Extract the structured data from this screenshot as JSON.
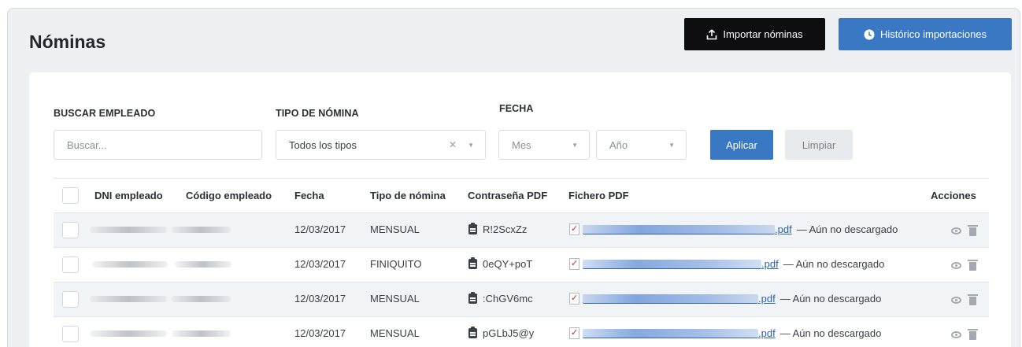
{
  "header": {
    "title": "Nóminas",
    "import_button": "Importar nóminas",
    "import_icon": "upload-icon",
    "history_button": "Histórico importaciones",
    "history_icon": "clock-icon"
  },
  "filters": {
    "search_label": "BUSCAR EMPLEADO",
    "search_placeholder": "Buscar...",
    "type_label": "TIPO DE NÓMINA",
    "type_value": "Todos los tipos",
    "date_label": "FECHA",
    "month_placeholder": "Mes",
    "year_placeholder": "Año",
    "apply_button": "Aplicar",
    "clear_button": "Limpiar"
  },
  "table": {
    "columns": {
      "dni": "DNI empleado",
      "code": "Código empleado",
      "date": "Fecha",
      "type": "Tipo de nómina",
      "password": "Contraseña PDF",
      "file": "Fichero PDF",
      "actions": "Acciones"
    },
    "rows": [
      {
        "date": "12/03/2017",
        "type": "MENSUAL",
        "password": "R!2ScxZz",
        "file_ext": ".pdf",
        "status": "— Aún no descargado"
      },
      {
        "date": "12/03/2017",
        "type": "FINIQUITO",
        "password": "0eQY+poT",
        "file_ext": ".pdf",
        "status": "— Aún no descargado"
      },
      {
        "date": "12/03/2017",
        "type": "MENSUAL",
        "password": ":ChGV6mc",
        "file_ext": ".pdf",
        "status": "— Aún no descargado"
      },
      {
        "date": "12/03/2017",
        "type": "MENSUAL",
        "password": "pGLbJ5@y",
        "file_ext": ".pdf",
        "status": "— Aún no descargado"
      }
    ]
  },
  "colors": {
    "primary": "#3a78c3",
    "dark_button": "#0e0e10",
    "link": "#2d5fb3"
  }
}
